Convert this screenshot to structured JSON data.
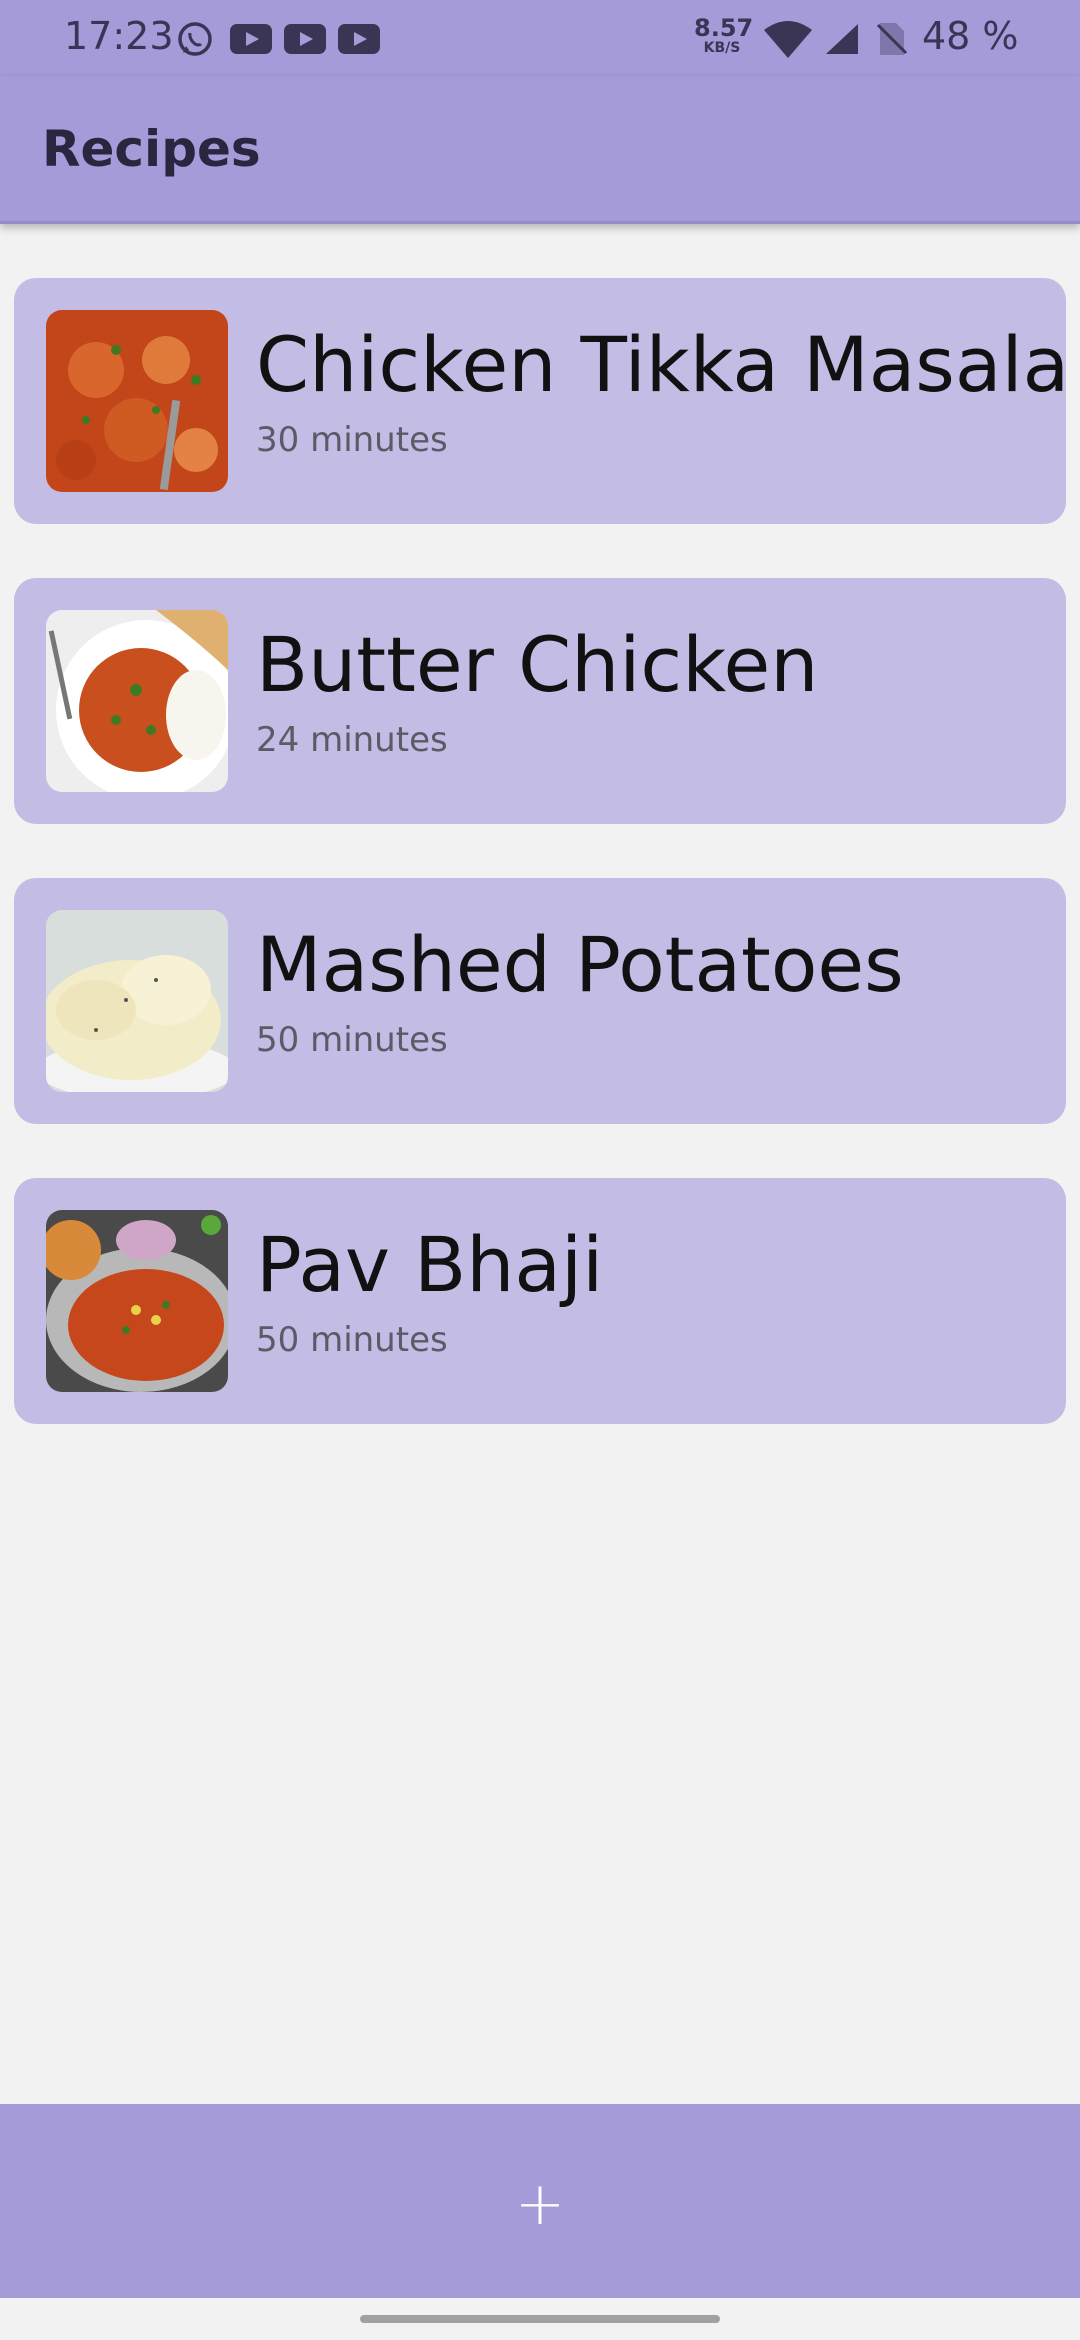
{
  "status_bar": {
    "time": "17:23",
    "net_speed_value": "8.57",
    "net_speed_unit": "KB/S",
    "battery": "48 %",
    "icons": [
      "whatsapp-icon",
      "youtube-icon",
      "youtube-icon",
      "youtube-icon",
      "wifi-icon",
      "signal-icon",
      "no-sim-icon"
    ]
  },
  "app_bar": {
    "title": "Recipes"
  },
  "recipes": [
    {
      "name": "Chicken Tikka Masala",
      "time": "30 minutes"
    },
    {
      "name": "Butter Chicken",
      "time": "24 minutes"
    },
    {
      "name": "Mashed Potatoes",
      "time": "50 minutes"
    },
    {
      "name": "Pav Bhaji",
      "time": "50 minutes"
    }
  ],
  "bottom_bar": {
    "add_label": "+"
  },
  "colors": {
    "accent": "#a59bd8",
    "card": "#c3bce5",
    "background": "#f2f2f2"
  }
}
